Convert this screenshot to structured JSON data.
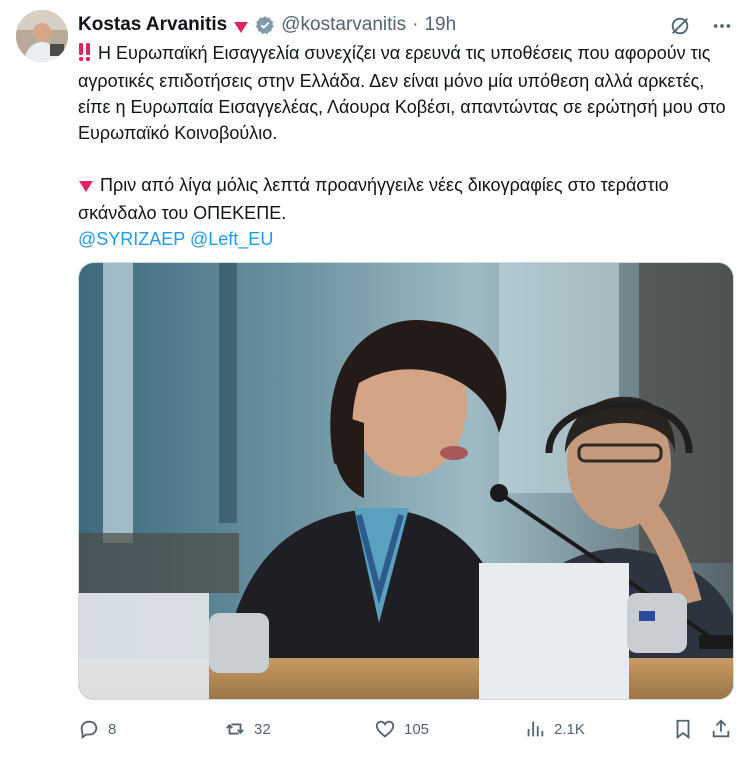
{
  "author": {
    "name": "Kostas Arvanitis",
    "handle": "@kostarvanitis",
    "separator": "·",
    "time": "19h"
  },
  "tweet": {
    "paragraph_1": "Η Ευρωπαϊκή Εισαγγελία συνεχίζει να ερευνά τις υποθέσεις που αφορούν τις αγροτικές επιδοτήσεις στην Ελλάδα. Δεν είναι μόνο μία υπόθεση αλλά αρκετές, είπε η Ευρωπαία Εισαγγελέας, Λάουρα Κοβέσι, απαντώντας σε ερώτησή μου στο Ευρωπαϊκό Κοινοβούλιο.",
    "paragraph_2": "Πριν από λίγα μόλις λεπτά προανήγγειλε νέες δικογραφίες στο τεράστιο σκάνδαλο του ΟΠΕΚΕΠΕ.",
    "mention_1": "@SYRIZAEP",
    "mention_2": "@Left_EU"
  },
  "stats": {
    "replies": "8",
    "reposts": "32",
    "likes": "105",
    "views": "2.1K"
  },
  "icons": {
    "double_exclamation": "double-exclamation-icon",
    "red_triangle": "red-triangle-down-icon",
    "verified": "verified-badge-icon",
    "grok": "grok-icon",
    "more": "more-icon"
  },
  "colors": {
    "accent": "#1d9bf0",
    "muted": "#536471",
    "emoji_red": "#e0245e"
  }
}
